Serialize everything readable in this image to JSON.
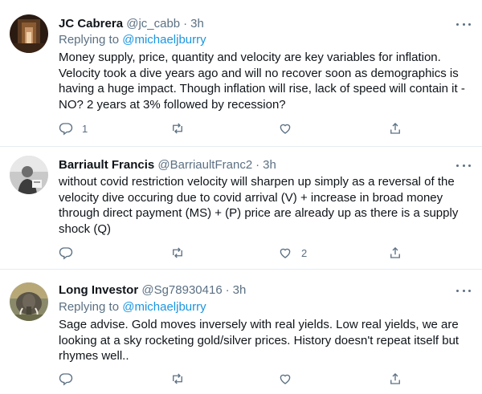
{
  "tweets": [
    {
      "name": "JC Cabrera",
      "handle": "@jc_cabb",
      "dot": "·",
      "time": "3h",
      "replying_label": "Replying to",
      "replying_to": "@michaeljburry",
      "text": "Money supply, price, quantity and velocity are key variables for inflation. Velocity took a dive years ago and will no recover soon as demographics is having a huge impact. Though inflation will rise, lack of speed will contain it - NO? 2 years at 3% followed by recession?",
      "reply_count": "1",
      "retweet_count": "",
      "like_count": ""
    },
    {
      "name": "Barriault Francis",
      "handle": "@BarriaultFranc2",
      "dot": "·",
      "time": "3h",
      "text": "without covid restriction velocity will sharpen up simply as a reversal of the velocity dive occuring due to covid arrival (V) + increase in broad money through direct payment (MS) + (P) price are already up as there is a supply shock (Q)",
      "reply_count": "",
      "retweet_count": "",
      "like_count": "2"
    },
    {
      "name": "Long Investor",
      "handle": "@Sg78930416",
      "dot": "·",
      "time": "3h",
      "replying_label": "Replying to",
      "replying_to": "@michaeljburry",
      "text": "Sage advise. Gold moves inversely with real yields. Low real yields, we are looking at a sky rocketing gold/silver prices. History doesn't repeat itself but rhymes well..",
      "reply_count": "",
      "retweet_count": "",
      "like_count": ""
    }
  ],
  "icons": [
    "reply-icon",
    "retweet-icon",
    "like-icon",
    "share-icon",
    "more-icon"
  ],
  "colors": {
    "secondary_text": "#5b7083",
    "mention": "#1b95e0",
    "divider": "#e6ecf0"
  }
}
